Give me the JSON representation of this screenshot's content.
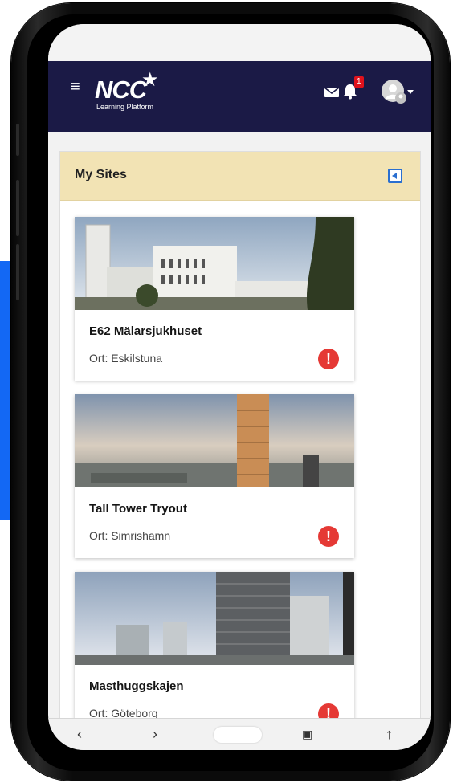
{
  "app": {
    "logo_text": "NCC",
    "logo_subtitle": "Learning Platform",
    "notification_count": "1",
    "brand_color": "#1b1a46",
    "alert_color": "#e53935"
  },
  "icons": {
    "menu": "hamburger-icon",
    "mail": "mail-icon",
    "bell": "bell-icon",
    "avatar": "avatar-icon",
    "collapse": "collapse-sidebar-icon",
    "alert": "alert-icon"
  },
  "sites": {
    "title": "My Sites",
    "items": [
      {
        "name": "E62 Mälarsjukhuset",
        "location": "Ort: Eskilstuna",
        "alert": "!"
      },
      {
        "name": "Tall Tower Tryout",
        "location": "Ort: Simrishamn",
        "alert": "!"
      },
      {
        "name": "Masthuggskajen",
        "location": "Ort: Göteborg",
        "alert": "!"
      }
    ]
  }
}
